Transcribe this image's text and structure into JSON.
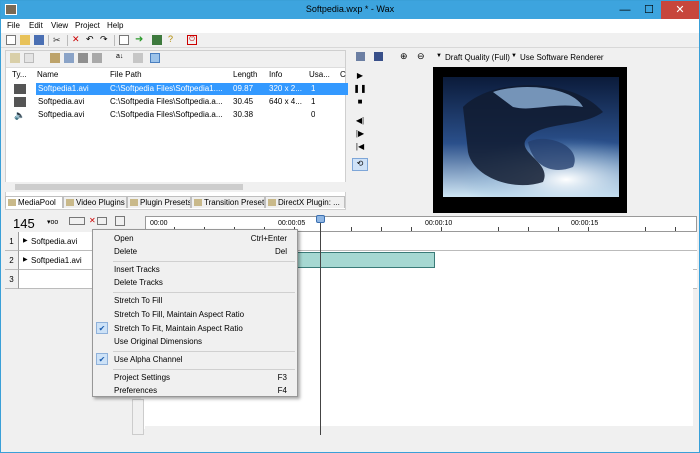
{
  "window": {
    "title": "Softpedia.wxp * - Wax",
    "min": "—",
    "max": "☐",
    "close": "✕"
  },
  "menu": [
    "File",
    "Edit",
    "View",
    "Project",
    "Help"
  ],
  "media_pool": {
    "columns": [
      "Ty...",
      "Name",
      "File Path",
      "Length",
      "Info",
      "Usa...",
      "C"
    ],
    "rows": [
      {
        "type_icon": "film-icon",
        "name": "Softpedia1.avi",
        "path": "C:\\Softpedia Files\\Softpedia1....",
        "length": "09.87",
        "info": "320 x 2...",
        "usage": "1",
        "selected": true
      },
      {
        "type_icon": "film-icon",
        "name": "Softpedia.avi",
        "path": "C:\\Softpedia Files\\Softpedia.a...",
        "length": "30.45",
        "info": "640 x 4...",
        "usage": "1",
        "selected": false
      },
      {
        "type_icon": "speaker-icon",
        "name": "Softpedia.avi",
        "path": "C:\\Softpedia Files\\Softpedia.a...",
        "length": "30.38",
        "info": "",
        "usage": "0",
        "selected": false
      }
    ]
  },
  "tabs": [
    "MediaPool",
    "Video Plugins",
    "Plugin Presets",
    "Transition Presets",
    "DirectX Plugin: ..."
  ],
  "preview": {
    "quality": "Draft Quality (Full)",
    "renderer": "Use Software Renderer"
  },
  "timeline": {
    "counter": "145",
    "ruler": [
      "00:00",
      "00:00:05",
      "00:00:10",
      "00:00:15"
    ],
    "tracks": [
      {
        "num": "1",
        "name": "Softpedia.avi"
      },
      {
        "num": "2",
        "name": "Softpedia1.avi"
      },
      {
        "num": "3",
        "name": ""
      }
    ]
  },
  "context_menu": [
    {
      "label": "Open",
      "shortcut": "Ctrl+Enter",
      "checked": false
    },
    {
      "label": "Delete",
      "shortcut": "Del",
      "checked": false
    },
    {
      "sep": true
    },
    {
      "label": "Insert Tracks",
      "shortcut": "",
      "checked": false
    },
    {
      "label": "Delete Tracks",
      "shortcut": "",
      "checked": false
    },
    {
      "sep": true
    },
    {
      "label": "Stretch To Fill",
      "shortcut": "",
      "checked": false
    },
    {
      "label": "Stretch To Fill, Maintain Aspect Ratio",
      "shortcut": "",
      "checked": false
    },
    {
      "label": "Stretch To Fit, Maintain Aspect Ratio",
      "shortcut": "",
      "checked": true
    },
    {
      "label": "Use Original Dimensions",
      "shortcut": "",
      "checked": false
    },
    {
      "sep": true
    },
    {
      "label": "Use Alpha Channel",
      "shortcut": "",
      "checked": true
    },
    {
      "sep": true
    },
    {
      "label": "Project Settings",
      "shortcut": "F3",
      "checked": false
    },
    {
      "label": "Preferences",
      "shortcut": "F4",
      "checked": false
    }
  ],
  "colors": {
    "titlebar": "#3da4de",
    "selection": "#3399ff",
    "clip": "#a6d8d2",
    "close": "#c7463c"
  }
}
